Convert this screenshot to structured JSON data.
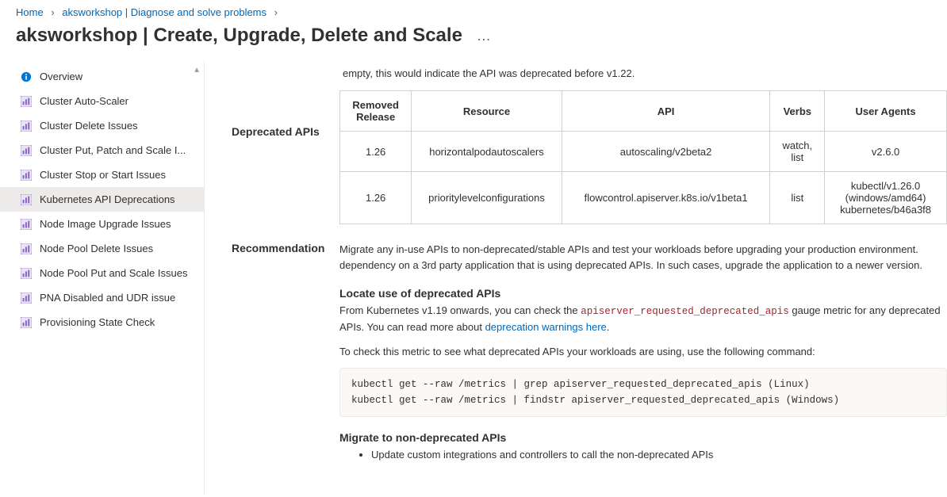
{
  "breadcrumb": {
    "home": "Home",
    "mid": "aksworkshop | Diagnose and solve problems"
  },
  "title": "aksworkshop | Create, Upgrade, Delete and Scale",
  "sidebar": {
    "overview": "Overview",
    "items": [
      "Cluster Auto-Scaler",
      "Cluster Delete Issues",
      "Cluster Put, Patch and Scale I...",
      "Cluster Stop or Start Issues",
      "Kubernetes API Deprecations",
      "Node Image Upgrade Issues",
      "Node Pool Delete Issues",
      "Node Pool Put and Scale Issues",
      "PNA Disabled and UDR issue",
      "Provisioning State Check"
    ]
  },
  "intro_para": "empty, this would indicate the API was deprecated before v1.22.",
  "deprecated_label": "Deprecated APIs",
  "table": {
    "headers": {
      "release": "Removed Release",
      "resource": "Resource",
      "api": "API",
      "verbs": "Verbs",
      "ua": "User Agents"
    },
    "rows": [
      {
        "release": "1.26",
        "resource": "horizontalpodautoscalers",
        "api": "autoscaling/v2beta2",
        "verbs": "watch, list",
        "ua": "v2.6.0"
      },
      {
        "release": "1.26",
        "resource": "prioritylevelconfigurations",
        "api": "flowcontrol.apiserver.k8s.io/v1beta1",
        "verbs": "list",
        "ua": "kubectl/v1.26.0 (windows/amd64) kubernetes/b46a3f8"
      }
    ]
  },
  "reco": {
    "label": "Recommendation",
    "para1": "Migrate any in-use APIs to non-deprecated/stable APIs and test your workloads before upgrading your production environment. dependency on a 3rd party application that is using deprecated APIs. In such cases, upgrade the application to a newer version.",
    "h_locate": "Locate use of deprecated APIs",
    "locate_p1a": "From Kubernetes v1.19 onwards, you can check the ",
    "locate_code": "apiserver_requested_deprecated_apis",
    "locate_p1b": " gauge metric for any deprecated APIs. You can read more about ",
    "locate_link": "deprecation warnings here",
    "locate_p2": "To check this metric to see what deprecated APIs your workloads are using, use the following command:",
    "cmd1": "kubectl get --raw /metrics | grep apiserver_requested_deprecated_apis (Linux)",
    "cmd2": "kubectl get --raw /metrics | findstr apiserver_requested_deprecated_apis (Windows)",
    "h_migrate": "Migrate to non-deprecated APIs",
    "migrate_b1": "Update custom integrations and controllers to call the non-deprecated APIs"
  }
}
